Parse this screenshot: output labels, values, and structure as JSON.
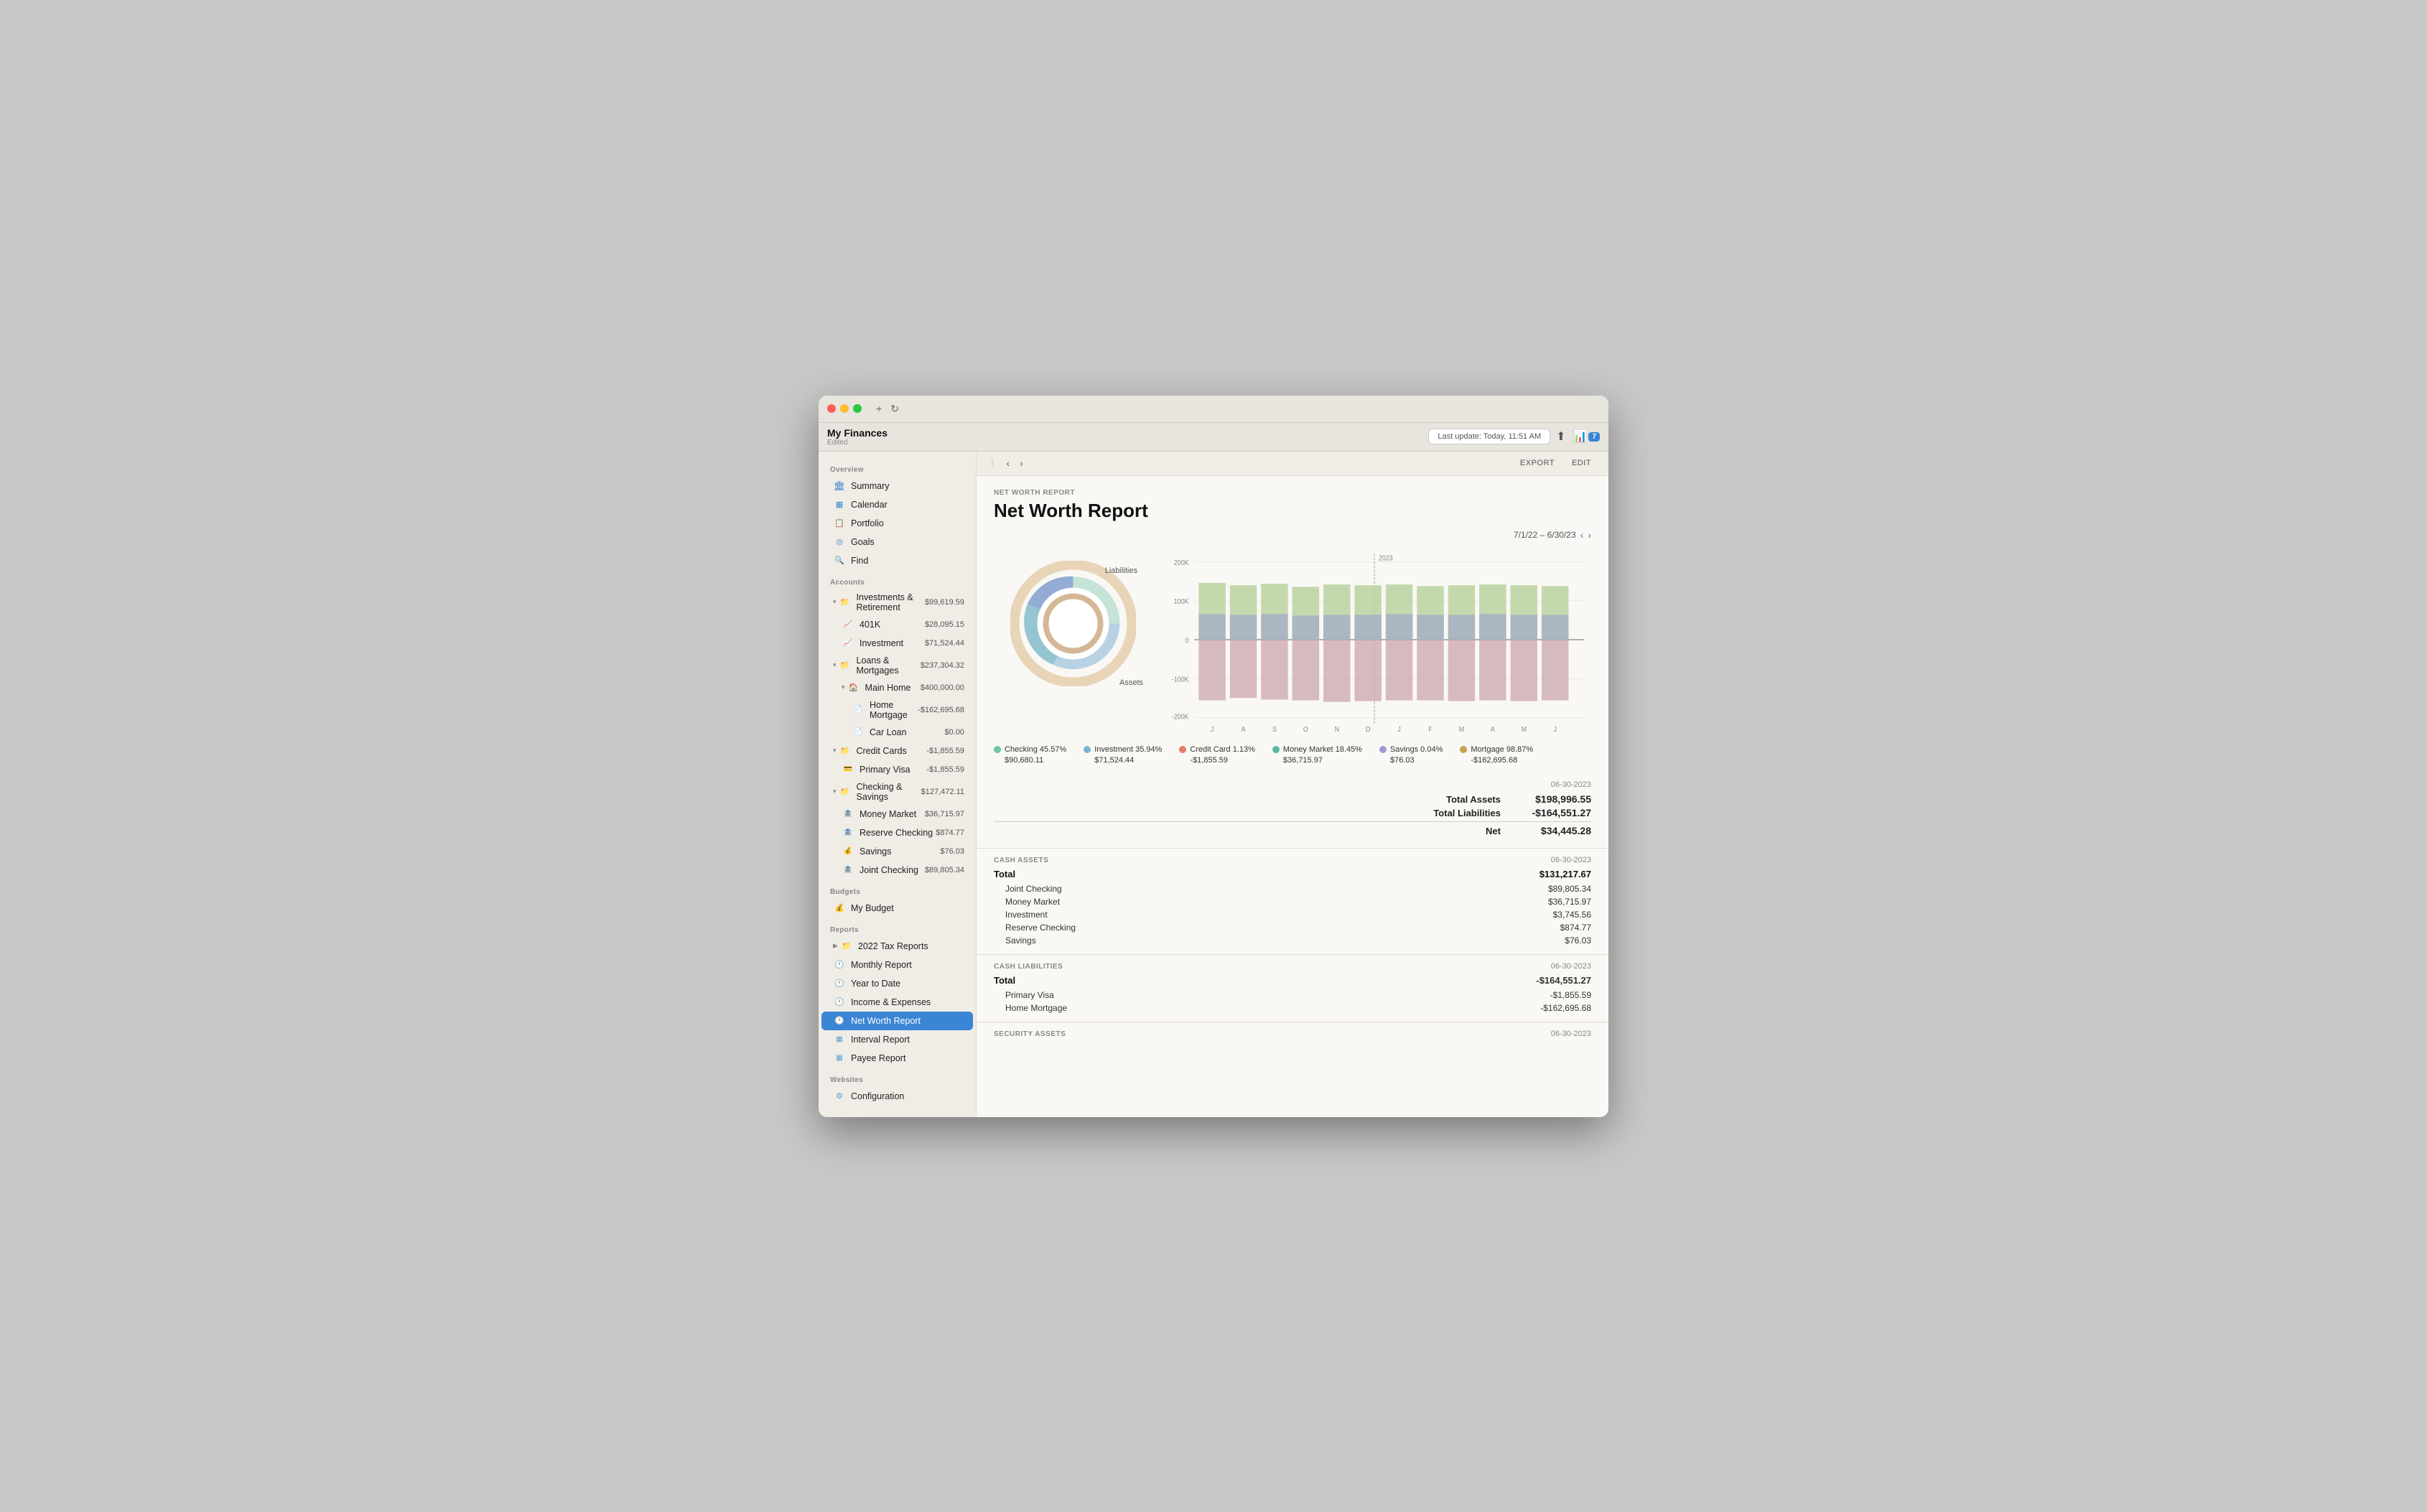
{
  "window": {
    "title": "My Finances",
    "subtitle": "Edited",
    "last_update": "Last update: Today, 11:51 AM",
    "notification_count": "7"
  },
  "toolbar": {
    "export_label": "EXPORT",
    "edit_label": "EDIT"
  },
  "report": {
    "label": "NET WORTH REPORT",
    "title": "Net Worth Report",
    "date_range": "7/1/22 – 6/30/23"
  },
  "summary": {
    "date": "06-30-2023",
    "total_assets_label": "Total Assets",
    "total_assets_value": "$198,996.55",
    "total_liabilities_label": "Total Liabilities",
    "total_liabilities_value": "-$164,551.27",
    "net_label": "Net",
    "net_value": "$34,445.28"
  },
  "legend": [
    {
      "color": "#6bc8a0",
      "name": "Checking 45.57%",
      "amount": "$90,680.11"
    },
    {
      "color": "#7ab3d4",
      "name": "Investment 35.94%",
      "amount": "$71,524.44"
    },
    {
      "color": "#e87c6a",
      "name": "Credit Card 1.13%",
      "amount": "-$1,855.59"
    },
    {
      "color": "#d4a96a",
      "name": "Money Market 18.45%",
      "amount": "$36,715.97"
    },
    {
      "color": "#9b9bd4",
      "name": "Savings 0.04%",
      "amount": "$76.03"
    },
    {
      "color": "#c8a050",
      "name": "Mortgage 98.87%",
      "amount": "-$162,695.68"
    }
  ],
  "cash_assets": {
    "label": "CASH ASSETS",
    "date": "06-30-2023",
    "total_label": "Total",
    "total_value": "$131,217.67",
    "rows": [
      {
        "name": "Joint Checking",
        "value": "$89,805.34"
      },
      {
        "name": "Money Market",
        "value": "$36,715.97"
      },
      {
        "name": "Investment",
        "value": "$3,745.56"
      },
      {
        "name": "Reserve Checking",
        "value": "$874.77"
      },
      {
        "name": "Savings",
        "value": "$76.03"
      }
    ]
  },
  "cash_liabilities": {
    "label": "CASH LIABILITIES",
    "date": "06-30-2023",
    "total_label": "Total",
    "total_value": "-$164,551.27",
    "rows": [
      {
        "name": "Primary Visa",
        "value": "-$1,855.59"
      },
      {
        "name": "Home Mortgage",
        "value": "-$162,695.68"
      }
    ]
  },
  "security_assets": {
    "label": "SECURITY ASSETS",
    "date": "06-30-2023"
  },
  "sidebar": {
    "overview_label": "Overview",
    "accounts_label": "Accounts",
    "budgets_label": "Budgets",
    "reports_label": "Reports",
    "websites_label": "Websites",
    "overview_items": [
      {
        "id": "summary",
        "label": "Summary",
        "icon": "🏛"
      },
      {
        "id": "calendar",
        "label": "Calendar",
        "icon": "📅"
      },
      {
        "id": "portfolio",
        "label": "Portfolio",
        "icon": "📋"
      },
      {
        "id": "goals",
        "label": "Goals",
        "icon": "🎯"
      },
      {
        "id": "find",
        "label": "Find",
        "icon": "🔍"
      }
    ],
    "accounts": [
      {
        "id": "investments",
        "label": "Investments & Retirement",
        "amount": "$99,619.59",
        "indent": 0,
        "type": "folder",
        "expanded": true
      },
      {
        "id": "401k",
        "label": "401K",
        "amount": "$28,095.15",
        "indent": 1,
        "type": "account"
      },
      {
        "id": "investment",
        "label": "Investment",
        "amount": "$71,524.44",
        "indent": 1,
        "type": "account"
      },
      {
        "id": "loans",
        "label": "Loans & Mortgages",
        "amount": "$237,304.32",
        "indent": 0,
        "type": "folder",
        "expanded": true
      },
      {
        "id": "main-home",
        "label": "Main Home",
        "amount": "$400,000.00",
        "indent": 1,
        "type": "subfolder",
        "expanded": true
      },
      {
        "id": "home-mortgage",
        "label": "Home Mortgage",
        "amount": "-$162,695.68",
        "indent": 2,
        "type": "account"
      },
      {
        "id": "car-loan",
        "label": "Car Loan",
        "amount": "$0.00",
        "indent": 2,
        "type": "account"
      },
      {
        "id": "credit-cards",
        "label": "Credit Cards",
        "amount": "-$1,855.59",
        "indent": 0,
        "type": "folder",
        "expanded": true
      },
      {
        "id": "primary-visa",
        "label": "Primary Visa",
        "amount": "-$1,855.59",
        "indent": 1,
        "type": "account"
      },
      {
        "id": "checking-savings",
        "label": "Checking & Savings",
        "amount": "$127,472.11",
        "indent": 0,
        "type": "folder",
        "expanded": true
      },
      {
        "id": "money-market",
        "label": "Money Market",
        "amount": "$36,715.97",
        "indent": 1,
        "type": "account"
      },
      {
        "id": "reserve-checking",
        "label": "Reserve Checking",
        "amount": "$874.77",
        "indent": 1,
        "type": "account"
      },
      {
        "id": "savings",
        "label": "Savings",
        "amount": "$76.03",
        "indent": 1,
        "type": "account"
      },
      {
        "id": "joint-checking",
        "label": "Joint Checking",
        "amount": "$89,805.34",
        "indent": 1,
        "type": "account"
      }
    ],
    "budget_items": [
      {
        "id": "my-budget",
        "label": "My Budget",
        "icon": "💰"
      }
    ],
    "report_items": [
      {
        "id": "2022-tax",
        "label": "2022 Tax Reports",
        "type": "folder"
      },
      {
        "id": "monthly-report",
        "label": "Monthly Report",
        "type": "report"
      },
      {
        "id": "year-to-date",
        "label": "Year to Date",
        "type": "report"
      },
      {
        "id": "income-expenses",
        "label": "Income & Expenses",
        "type": "report"
      },
      {
        "id": "net-worth",
        "label": "Net Worth Report",
        "type": "report",
        "active": true
      },
      {
        "id": "interval-report",
        "label": "Interval Report",
        "type": "report2"
      },
      {
        "id": "payee-report",
        "label": "Payee Report",
        "type": "report2"
      }
    ],
    "website_items": [
      {
        "id": "configuration",
        "label": "Configuration",
        "icon": "⚙"
      }
    ]
  },
  "bar_chart": {
    "y_labels": [
      "200K",
      "100K",
      "0",
      "-100K",
      "-200K"
    ],
    "x_labels": [
      "J",
      "A",
      "S",
      "O",
      "N",
      "D",
      "J",
      "F",
      "M",
      "A",
      "M",
      "J"
    ],
    "year_marker": "2023",
    "bars": [
      {
        "assets": 170,
        "investments": 55,
        "liabilities": -130
      },
      {
        "assets": 165,
        "investments": 55,
        "liabilities": -125
      },
      {
        "assets": 168,
        "investments": 55,
        "liabilities": -127
      },
      {
        "assets": 162,
        "investments": 55,
        "liabilities": -128
      },
      {
        "assets": 164,
        "investments": 55,
        "liabilities": -130
      },
      {
        "assets": 163,
        "investments": 55,
        "liabilities": -129
      },
      {
        "assets": 165,
        "investments": 55,
        "liabilities": -128
      },
      {
        "assets": 163,
        "investments": 55,
        "liabilities": -128
      },
      {
        "assets": 163,
        "investments": 55,
        "liabilities": -129
      },
      {
        "assets": 165,
        "investments": 55,
        "liabilities": -128
      },
      {
        "assets": 164,
        "investments": 55,
        "liabilities": -129
      },
      {
        "assets": 163,
        "investments": 55,
        "liabilities": -128
      }
    ]
  }
}
